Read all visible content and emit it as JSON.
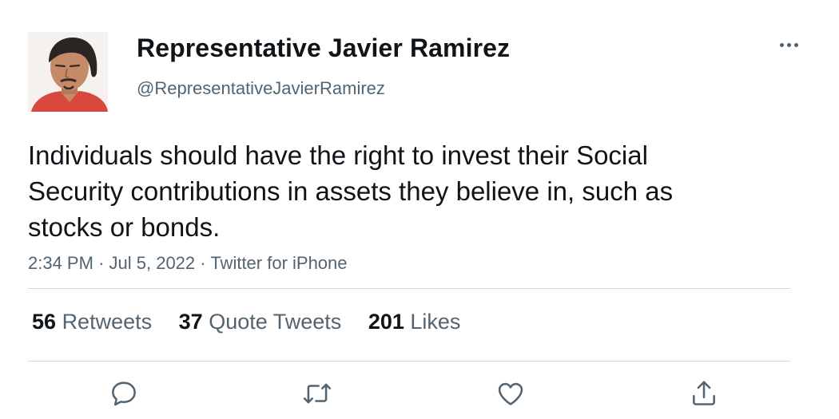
{
  "user": {
    "display_name": "Representative Javier Ramirez",
    "handle": "@RepresentativeJavierRamirez"
  },
  "tweet": {
    "text": "Individuals should have the right to invest their Social Security contributions in assets they believe in, such as stocks or bonds.",
    "time": "2:34 PM",
    "date": "Jul 5, 2022",
    "source": "Twitter for iPhone",
    "separator": "·"
  },
  "stats": {
    "retweets": {
      "count": "56",
      "label": "Retweets"
    },
    "quote_tweets": {
      "count": "37",
      "label": "Quote Tweets"
    },
    "likes": {
      "count": "201",
      "label": "Likes"
    }
  },
  "actions": [
    "reply-icon",
    "retweet-icon",
    "like-icon",
    "share-icon"
  ],
  "colors": {
    "text": "#0f1419",
    "secondary": "#536471",
    "divider": "#cfd9de"
  }
}
